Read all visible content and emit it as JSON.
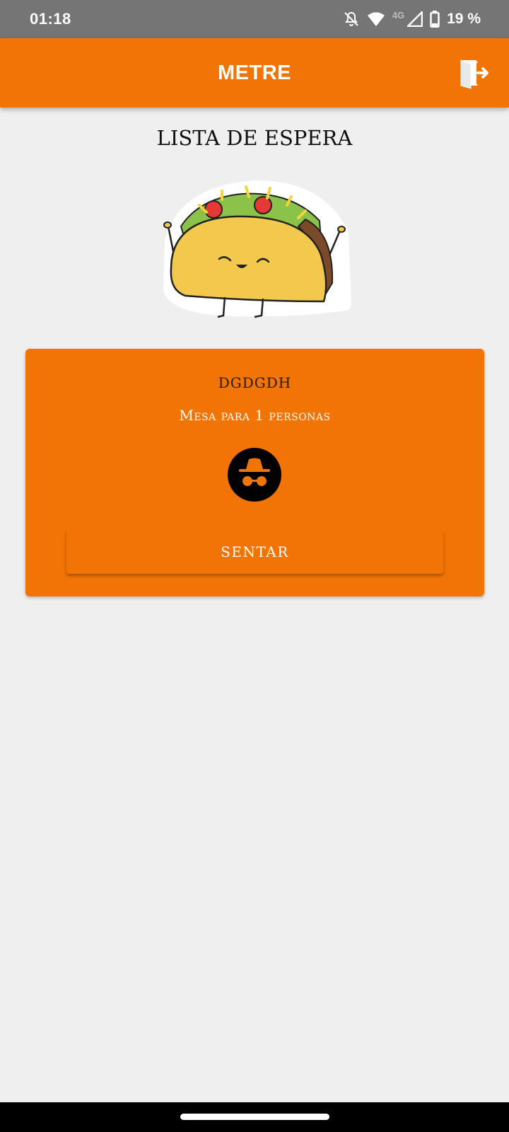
{
  "status_bar": {
    "time": "01:18",
    "network": "4G",
    "battery": "19 %",
    "icons": [
      "bell-off-icon",
      "wifi-icon",
      "signal-icon",
      "battery-icon"
    ]
  },
  "app_bar": {
    "title": "METRE",
    "logout_icon": "logout-door-icon",
    "color": "#f27405"
  },
  "page": {
    "heading": "LISTA DE ESPERA"
  },
  "waiting_card": {
    "customer_name": "DGDGDH",
    "table_info": "Mesa para 1 personas",
    "avatar_icon": "incognito-icon",
    "seat_button_label": "SENTAR"
  }
}
